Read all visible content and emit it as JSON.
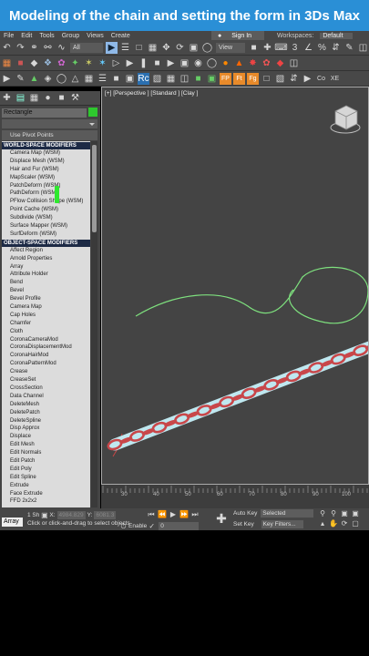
{
  "banner": {
    "title": "Modeling of the chain and setting the form in 3Ds Max"
  },
  "menu": {
    "items": [
      "File",
      "Edit",
      "Tools",
      "Group",
      "Views",
      "Create"
    ],
    "sign_in": "Sign In",
    "workspaces_label": "Workspaces:",
    "workspaces_value": "Default"
  },
  "toolbar": {
    "filter_value": "All",
    "view_value": "View"
  },
  "command_panel": {
    "object_name": "Rectangle",
    "object_color": "#2ec82e",
    "pivot_button": "Use Pivot Points",
    "world_header": "WORLD-SPACE MODIFIERS",
    "world_items": [
      "Camera Map (WSM)",
      "Displace Mesh (WSM)",
      "Hair and Fur (WSM)",
      "MapScaler (WSM)",
      "PatchDeform (WSM)",
      "PathDeform (WSM)",
      "PFlow Collision Shape (WSM)",
      "Point Cache (WSM)",
      "Subdivide (WSM)",
      "Surface Mapper (WSM)",
      "SurfDeform (WSM)"
    ],
    "object_header": "OBJECT-SPACE MODIFIERS",
    "object_items": [
      "Affect Region",
      "Arnold Properties",
      "Array",
      "Attribute Holder",
      "Bend",
      "Bevel",
      "Bevel Profile",
      "Camera Map",
      "Cap Holes",
      "Chamfer",
      "Cloth",
      "CoronaCameraMod",
      "CoronaDisplacementMod",
      "CoronaHairMod",
      "CoronaPatternMod",
      "Crease",
      "CreaseSet",
      "CrossSection",
      "Data Channel",
      "DeleteMesh",
      "DeletePatch",
      "DeleteSpline",
      "Disp Approx",
      "Displace",
      "Edit Mesh",
      "Edit Normals",
      "Edit Patch",
      "Edit Poly",
      "Edit Spline",
      "Extrude",
      "Face Extrude",
      "FFD 2x2x2"
    ]
  },
  "viewport": {
    "label": "[+] [Perspective ] [Standard ] [Clay ]",
    "chain_color": "#c8474a",
    "curve_color": "#7ee07e"
  },
  "timeline": {
    "ticks": [
      "30",
      "40",
      "50",
      "60",
      "70",
      "80",
      "90",
      "100"
    ]
  },
  "status": {
    "listener": "Array",
    "hint": "Click or click-and-drag to select objects",
    "frame_count": "1 Sh",
    "x_label": "X:",
    "x_value": "4984.829",
    "y_label": "Y:",
    "y_value": "6081.3",
    "enable_label": "Enable",
    "auto_key": "Auto Key",
    "selected_value": "Selected",
    "set_key": "Set Key",
    "key_filters": "Key Filters...",
    "frame_value": "0"
  }
}
